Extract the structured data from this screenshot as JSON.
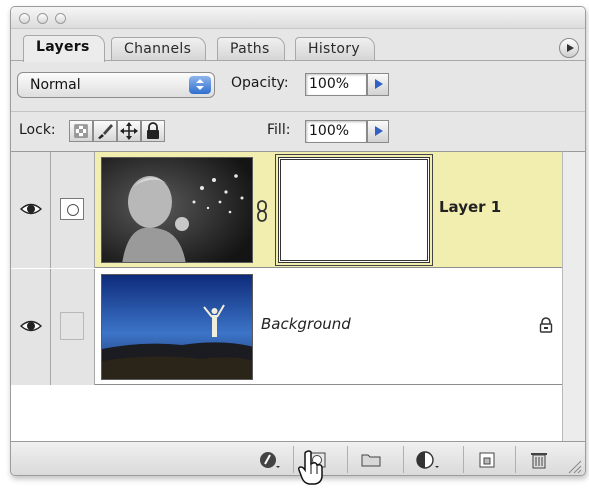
{
  "tabs": [
    "Layers",
    "Channels",
    "Paths",
    "History"
  ],
  "blend_mode": "Normal",
  "opacity": {
    "label": "Opacity:",
    "value": "100%"
  },
  "lock": {
    "label": "Lock:"
  },
  "fill": {
    "label": "Fill:",
    "value": "100%"
  },
  "layers": [
    {
      "name": "Layer 1",
      "visible": true,
      "selected": true,
      "has_mask": true
    },
    {
      "name": "Background",
      "visible": true,
      "selected": false,
      "locked": true
    }
  ],
  "colors": {
    "selected_layer": "#f1eeb0",
    "accent_blue": "#2f6fce"
  },
  "icons": [
    "layer-style-icon",
    "add-mask-icon",
    "new-group-icon",
    "adjustment-layer-icon",
    "new-layer-icon",
    "trash-icon",
    "hand-cursor-icon"
  ]
}
